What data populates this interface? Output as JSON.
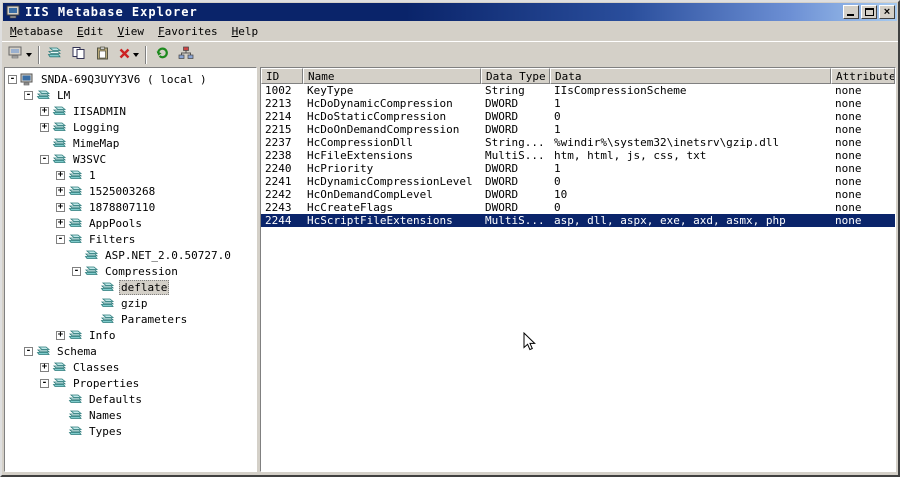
{
  "window": {
    "title": "IIS Metabase Explorer"
  },
  "menu": {
    "items": [
      "Metabase",
      "Edit",
      "View",
      "Favorites",
      "Help"
    ]
  },
  "toolbar": {
    "items": [
      {
        "icon": "connect-icon",
        "caret": true
      },
      {
        "sep": true
      },
      {
        "icon": "new-key-icon"
      },
      {
        "icon": "copy-icon"
      },
      {
        "icon": "paste-icon"
      },
      {
        "icon": "delete-icon",
        "caret": true
      },
      {
        "sep": true
      },
      {
        "icon": "refresh-icon"
      },
      {
        "icon": "hierarchy-icon"
      }
    ]
  },
  "tree": {
    "items": [
      {
        "label": "SNDA-69Q3UYY3V6 ( local )",
        "depth": 0,
        "expander": "minus",
        "icon": "computer-icon",
        "selected": false
      },
      {
        "label": "LM",
        "depth": 1,
        "expander": "minus",
        "icon": "metabase-key-icon",
        "selected": false
      },
      {
        "label": "IISADMIN",
        "depth": 2,
        "expander": "plus",
        "icon": "metabase-key-icon",
        "selected": false
      },
      {
        "label": "Logging",
        "depth": 2,
        "expander": "plus",
        "icon": "metabase-key-icon",
        "selected": false
      },
      {
        "label": "MimeMap",
        "depth": 2,
        "expander": null,
        "icon": "metabase-key-icon",
        "selected": false
      },
      {
        "label": "W3SVC",
        "depth": 2,
        "expander": "minus",
        "icon": "metabase-key-icon",
        "selected": false
      },
      {
        "label": "1",
        "depth": 3,
        "expander": "plus",
        "icon": "metabase-key-icon",
        "selected": false
      },
      {
        "label": "1525003268",
        "depth": 3,
        "expander": "plus",
        "icon": "metabase-key-icon",
        "selected": false
      },
      {
        "label": "1878807110",
        "depth": 3,
        "expander": "plus",
        "icon": "metabase-key-icon",
        "selected": false
      },
      {
        "label": "AppPools",
        "depth": 3,
        "expander": "plus",
        "icon": "metabase-key-icon",
        "selected": false
      },
      {
        "label": "Filters",
        "depth": 3,
        "expander": "minus",
        "icon": "metabase-key-icon",
        "selected": false
      },
      {
        "label": "ASP.NET_2.0.50727.0",
        "depth": 4,
        "expander": null,
        "icon": "metabase-key-icon",
        "selected": false
      },
      {
        "label": "Compression",
        "depth": 4,
        "expander": "minus",
        "icon": "metabase-key-icon",
        "selected": false
      },
      {
        "label": "deflate",
        "depth": 5,
        "expander": null,
        "icon": "metabase-key-icon",
        "selected": true
      },
      {
        "label": "gzip",
        "depth": 5,
        "expander": null,
        "icon": "metabase-key-icon",
        "selected": false
      },
      {
        "label": "Parameters",
        "depth": 5,
        "expander": null,
        "icon": "metabase-key-icon",
        "selected": false
      },
      {
        "label": "Info",
        "depth": 3,
        "expander": "plus",
        "icon": "metabase-key-icon",
        "selected": false
      },
      {
        "label": "Schema",
        "depth": 1,
        "expander": "minus",
        "icon": "metabase-key-icon",
        "selected": false
      },
      {
        "label": "Classes",
        "depth": 2,
        "expander": "plus",
        "icon": "metabase-key-icon",
        "selected": false
      },
      {
        "label": "Properties",
        "depth": 2,
        "expander": "minus",
        "icon": "metabase-key-icon",
        "selected": false
      },
      {
        "label": "Defaults",
        "depth": 3,
        "expander": null,
        "icon": "metabase-key-icon",
        "selected": false
      },
      {
        "label": "Names",
        "depth": 3,
        "expander": null,
        "icon": "metabase-key-icon",
        "selected": false
      },
      {
        "label": "Types",
        "depth": 3,
        "expander": null,
        "icon": "metabase-key-icon",
        "selected": false
      }
    ]
  },
  "table": {
    "columns": [
      "ID",
      "Name",
      "Data Type",
      "Data",
      "Attributes"
    ],
    "selected_row": 10,
    "rows": [
      [
        "1002",
        "KeyType",
        "String",
        "IIsCompressionScheme",
        "none"
      ],
      [
        "2213",
        "HcDoDynamicCompression",
        "DWORD",
        "1",
        "none"
      ],
      [
        "2214",
        "HcDoStaticCompression",
        "DWORD",
        "0",
        "none"
      ],
      [
        "2215",
        "HcDoOnDemandCompression",
        "DWORD",
        "1",
        "none"
      ],
      [
        "2237",
        "HcCompressionDll",
        "String...",
        "%windir%\\system32\\inetsrv\\gzip.dll",
        "none"
      ],
      [
        "2238",
        "HcFileExtensions",
        "MultiS...",
        "htm, html, js, css, txt",
        "none"
      ],
      [
        "2240",
        "HcPriority",
        "DWORD",
        "1",
        "none"
      ],
      [
        "2241",
        "HcDynamicCompressionLevel",
        "DWORD",
        "0",
        "none"
      ],
      [
        "2242",
        "HcOnDemandCompLevel",
        "DWORD",
        "10",
        "none"
      ],
      [
        "2243",
        "HcCreateFlags",
        "DWORD",
        "0",
        "none"
      ],
      [
        "2244",
        "HcScriptFileExtensions",
        "MultiS...",
        "asp, dll, aspx, exe, axd, asmx, php",
        "none"
      ]
    ]
  }
}
